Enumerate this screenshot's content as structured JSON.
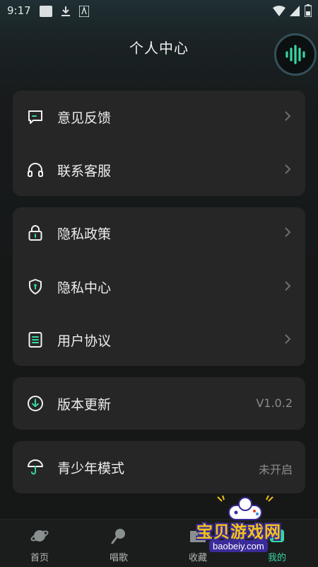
{
  "status_bar": {
    "time": "9:17"
  },
  "header": {
    "title": "个人中心"
  },
  "groups": [
    {
      "items": [
        {
          "label": "意见反馈",
          "icon": "message-square-icon"
        },
        {
          "label": "联系客服",
          "icon": "headphones-icon"
        }
      ]
    },
    {
      "items": [
        {
          "label": "隐私政策",
          "icon": "lock-icon"
        },
        {
          "label": "隐私中心",
          "icon": "shield-icon"
        },
        {
          "label": "用户协议",
          "icon": "document-icon"
        }
      ]
    },
    {
      "items": [
        {
          "label": "版本更新",
          "icon": "download-circle-icon",
          "value": "V1.0.2"
        }
      ]
    },
    {
      "items": [
        {
          "label": "青少年模式",
          "icon": "umbrella-icon",
          "value": "未开启"
        }
      ]
    }
  ],
  "tabs": [
    {
      "label": "首页",
      "icon": "planet-icon",
      "active": false
    },
    {
      "label": "唱歌",
      "icon": "microphone-icon",
      "active": false
    },
    {
      "label": "收藏",
      "icon": "folder-icon",
      "active": false
    },
    {
      "label": "我的",
      "icon": "person-icon",
      "active": true
    }
  ],
  "watermark": {
    "text": "宝贝游戏网",
    "url": "baobeiy.com"
  },
  "colors": {
    "accent": "#38d6a3",
    "card": "#262626",
    "background": "#161818"
  }
}
